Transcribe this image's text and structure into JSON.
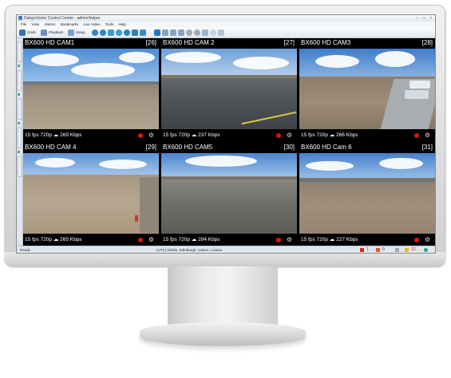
{
  "window": {
    "title": "DahgoVision Control Center - admin/helper"
  },
  "menu": [
    "File",
    "View",
    "Alarms",
    "Bookmarks",
    "Live Video",
    "Tools",
    "Help"
  ],
  "toolbar": {
    "grids_label": "Grids",
    "playback_label": "Playback",
    "setup_label": "Setup"
  },
  "colors": {
    "record_dot": "#e01515",
    "screen_bg": "#000000",
    "status_green": "#2fa36a"
  },
  "cameras": [
    {
      "name": "BX600 HD CAM1",
      "id": "[26]",
      "stats": "15 fps  720p ☁ 269 Kbps"
    },
    {
      "name": "BX600 HD CAM 2",
      "id": "[27]",
      "stats": "15 fps  720p ☁ 237 Kbps"
    },
    {
      "name": "BX600 HD CAM3",
      "id": "[28]",
      "stats": "15 fps  720p ☁ 266 Kbps"
    },
    {
      "name": "BX600 HD CAM 4",
      "id": "[29]",
      "stats": "15 fps   720p ☁ 265 Kbps"
    },
    {
      "name": "BX600 HD CAM5",
      "id": "[30]",
      "stats": "15 fps   720p ☁ 284 Kbps"
    },
    {
      "name": "BX600 HD Cam 6",
      "id": "[31]",
      "stats": "15 fps   720p ☁ 227 Kbps"
    }
  ],
  "status": {
    "ready": "Ready",
    "location": "(UTC) Dublin, Edinburgh, Lisbon, London",
    "alarm_count": "1",
    "unack_count": "0",
    "warning_count": "12"
  }
}
